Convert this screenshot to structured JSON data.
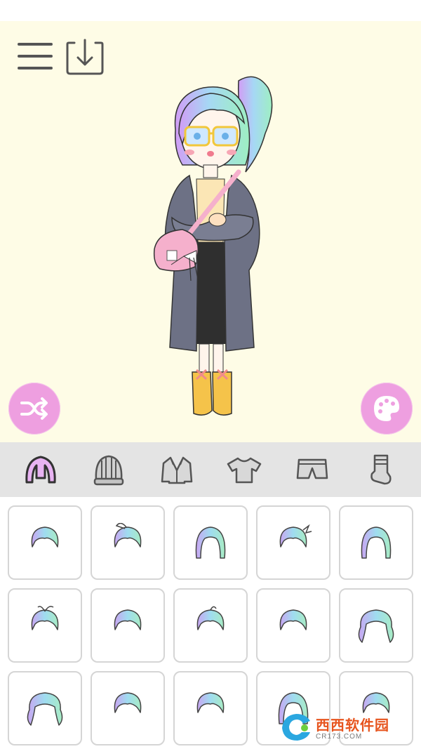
{
  "app": {
    "background": "#fefce6",
    "accent": "#ee9fe0",
    "tabbar_bg": "#e4e4e4"
  },
  "toolbar": {
    "menu_icon": "hamburger-menu-icon",
    "download_icon": "download-icon"
  },
  "actions": {
    "shuffle_icon": "shuffle-icon",
    "palette_icon": "palette-icon"
  },
  "character": {
    "hair_colors": [
      "#c9a6f2",
      "#9fdcf0",
      "#a8ecc4"
    ],
    "coat_color": "#6d7185",
    "bag_color": "#f5b0cc"
  },
  "tabs": [
    {
      "id": "hair",
      "icon": "hair-icon",
      "selected": true
    },
    {
      "id": "hat",
      "icon": "beanie-icon",
      "selected": false
    },
    {
      "id": "jacket",
      "icon": "jacket-icon",
      "selected": false
    },
    {
      "id": "top",
      "icon": "tshirt-icon",
      "selected": false
    },
    {
      "id": "bottom",
      "icon": "shorts-icon",
      "selected": false
    },
    {
      "id": "socks",
      "icon": "sock-icon",
      "selected": false
    }
  ],
  "hair_items": [
    "bob-hair",
    "curl-antenna-hair",
    "side-part-hair",
    "messy-hair",
    "long-straight-hair",
    "sprout-hair",
    "short-fluffy-hair",
    "ahoge-hair",
    "bangs-hair",
    "twin-tail-hair",
    "wavy-long-hair",
    "short-bob-hair",
    "blunt-bangs-hair",
    "loop-ponytail-hair",
    "mid-length-hair"
  ],
  "watermark": {
    "main": "西西软件园",
    "sub": "CR173.COM"
  }
}
